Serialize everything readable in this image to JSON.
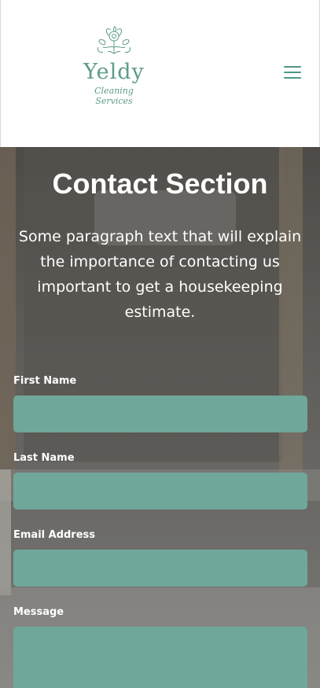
{
  "brand": {
    "name": "Yeldy",
    "tagline": "Cleaning Services",
    "color": "#5e9b8b"
  },
  "header": {
    "menu_icon": "hamburger-menu-icon"
  },
  "hero": {
    "title": "Contact Section",
    "intro": "Some paragraph text that will explain the importance of contacting us important to get a housekeeping estimate."
  },
  "form": {
    "accent": "#6fa79a",
    "fields": {
      "first_name": {
        "label": "First Name",
        "value": ""
      },
      "last_name": {
        "label": "Last Name",
        "value": ""
      },
      "email": {
        "label": "Email Address",
        "value": ""
      },
      "message": {
        "label": "Message",
        "value": ""
      }
    }
  }
}
